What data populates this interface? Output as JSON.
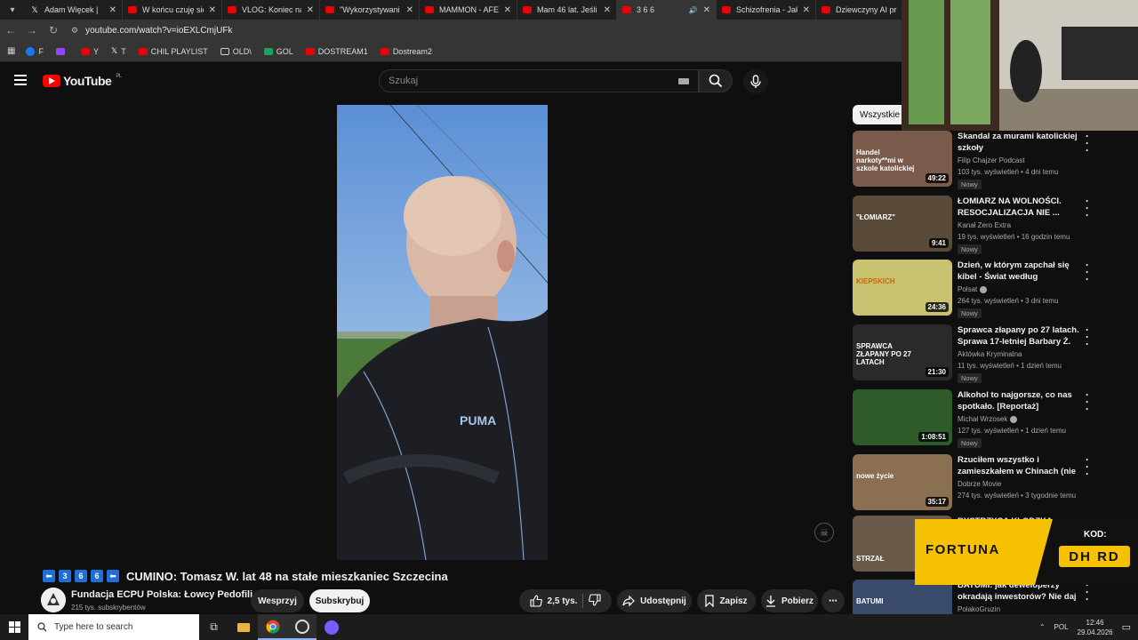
{
  "tabs": [
    {
      "title": "Adam Więcek |",
      "icon": "x"
    },
    {
      "title": "W końcu czuję się",
      "icon": "youtube"
    },
    {
      "title": "VLOG: Koniec na",
      "icon": "youtube"
    },
    {
      "title": "\"Wykorzystywani",
      "icon": "youtube"
    },
    {
      "title": "MAMMON - AFER",
      "icon": "youtube"
    },
    {
      "title": "Mam 46 lat. Jeśli",
      "icon": "youtube"
    },
    {
      "title": "3 6 6",
      "icon": "youtube",
      "active": true,
      "audio": true
    },
    {
      "title": "Schizofrenia - Jak",
      "icon": "youtube"
    },
    {
      "title": "Dziewczyny AI pro",
      "icon": "youtube"
    }
  ],
  "address": {
    "url": "youtube.com/watch?v=ioEXLCmjUFk"
  },
  "bookmarks": [
    {
      "label": "F",
      "icon": "facebook"
    },
    {
      "label": "",
      "icon": "twitch"
    },
    {
      "label": "Y",
      "icon": "youtube"
    },
    {
      "label": "T",
      "icon": "x"
    },
    {
      "label": "CHIL PLAYLIST",
      "icon": "youtube"
    },
    {
      "label": "OLD\\",
      "icon": "folder"
    },
    {
      "label": "GOL",
      "icon": "g"
    },
    {
      "label": "DOSTREAM1",
      "icon": "youtube"
    },
    {
      "label": "Dostream2",
      "icon": "youtube"
    }
  ],
  "header": {
    "logo_text": "YouTube",
    "country": "PL",
    "search_placeholder": "Szukaj"
  },
  "video": {
    "title_badges": [
      "3",
      "6",
      "6"
    ],
    "title": "CUMINO: Tomasz W. lat 48 na stałe mieszkaniec Szczecina",
    "channel": "Fundacja ECPU Polska: Łowcy Pedofili",
    "subscribers": "215 tys. subskrybentów",
    "likes": "2,5 tys."
  },
  "actions": {
    "support": "Wesprzyj",
    "subscribe": "Subskrybuj",
    "share": "Udostępnij",
    "save": "Zapisz",
    "download": "Pobierz"
  },
  "sidebar": {
    "chip": "Wszystkie",
    "items": [
      {
        "title": "Skandal za murami katolickiej szkoły",
        "channel": "Filip Chajzer Podcast",
        "meta": "103 tys. wyświetleń • 4 dni temu",
        "badge": "Nowy",
        "duration": "49:22",
        "verified": false,
        "thumb": "#7a5a4a",
        "thumb_text": "Handel narkoty**mi w szkole katolickiej"
      },
      {
        "title": "ŁOMIARZ NA WOLNOŚCI. RESOCJALIZACJA NIE ...",
        "channel": "Kanał Zero Extra",
        "meta": "19 tys. wyświetleń • 16 godzin temu",
        "badge": "Nowy",
        "duration": "9:41",
        "verified": false,
        "thumb": "#5a4a3a",
        "thumb_text": "\"ŁOMIARZ\""
      },
      {
        "title": "Dzień, w którym zapchał się kibel - Świat według Kiepskich...",
        "channel": "Polsat",
        "meta": "264 tys. wyświetleń • 3 dni temu",
        "badge": "Nowy",
        "duration": "24:36",
        "verified": true,
        "thumb": "#c9c270",
        "thumb_text": "KIEPSKICH"
      },
      {
        "title": "Sprawca złapany po 27 latach. Sprawa 17-letniej Barbary Ż.",
        "channel": "Aktówka Kryminalna",
        "meta": "11 tys. wyświetleń • 1 dzień temu",
        "badge": "Nowy",
        "duration": "21:30",
        "verified": false,
        "thumb": "#2a2a2a",
        "thumb_text": "SPRAWCA ZŁAPANY PO 27 LATACH"
      },
      {
        "title": "Alkohol to najgorsze, co nas spotkało. [Reportaż]",
        "channel": "Michał Wrzosek",
        "meta": "127 tys. wyświetleń • 1 dzień temu",
        "badge": "Nowy",
        "duration": "1:08:51",
        "verified": true,
        "thumb": "#2f5a2a",
        "thumb_text": ""
      },
      {
        "title": "Rzuciłem wszystko i zamieszkałem w Chinach (nie ...",
        "channel": "Dobrze Movie",
        "meta": "274 tys. wyświetleń • 3 tygodnie temu",
        "badge": "",
        "duration": "35:17",
        "verified": false,
        "thumb": "#8a7050",
        "thumb_text": "nowe życie"
      },
      {
        "title": "BYSTRZYCA KŁODZKA",
        "channel": "",
        "meta": "",
        "badge": "",
        "duration": "",
        "verified": false,
        "thumb": "#6a5a4a",
        "thumb_text": "STRZAŁ"
      },
      {
        "title": "BATUMI: jak deweloperzy okradają inwestorów? Nie daj ...",
        "channel": "PolakoGruzin",
        "meta": "",
        "badge": "",
        "duration": "",
        "verified": false,
        "thumb": "#3a4a6a",
        "thumb_text": "BATUMI"
      }
    ]
  },
  "ad": {
    "brand": "FORTUNA",
    "code_label": "KOD:",
    "code": "DH RD"
  },
  "taskbar": {
    "search_placeholder": "Type here to search",
    "lang": "POL",
    "time": "12:46",
    "date": "29.04.2026"
  },
  "colors": {
    "accent": "#ff0000",
    "background": "#0f0f0f",
    "fortuna_yellow": "#f5c100"
  }
}
